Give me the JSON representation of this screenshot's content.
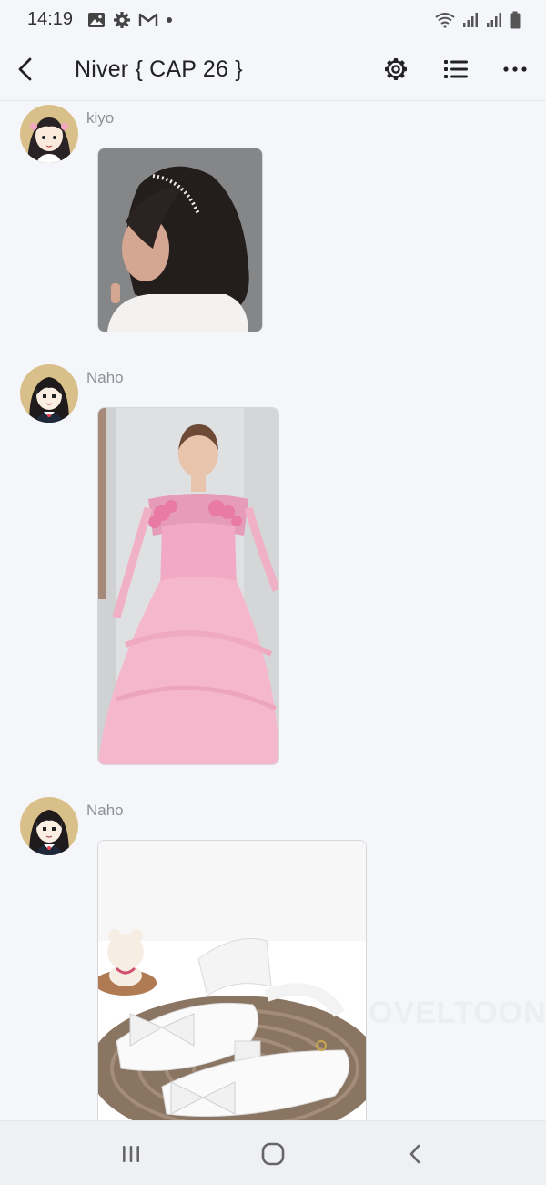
{
  "status_bar": {
    "time": "14:19",
    "left_icons": [
      "image-icon",
      "settings-icon",
      "gmail-icon",
      "dot-icon"
    ],
    "right_icons": [
      "wifi-icon",
      "signal-icon",
      "signal-icon",
      "battery-icon"
    ]
  },
  "header": {
    "title": "Niver { CAP 26 }",
    "icons": [
      "back-icon",
      "gear-icon",
      "list-icon",
      "more-icon"
    ]
  },
  "messages": [
    {
      "username": "kiyo",
      "type": "image",
      "image_desc": "girl with dark hair and pearl headband"
    },
    {
      "username": "Naho",
      "type": "image",
      "image_desc": "girl in pink ball gown"
    },
    {
      "username": "Naho",
      "type": "image",
      "image_desc": "white bow sandals with teddy bear"
    }
  ],
  "watermark": "OVELTOON",
  "nav_bar": {
    "icons": [
      "recent-apps-icon",
      "home-icon",
      "back-nav-icon"
    ]
  }
}
